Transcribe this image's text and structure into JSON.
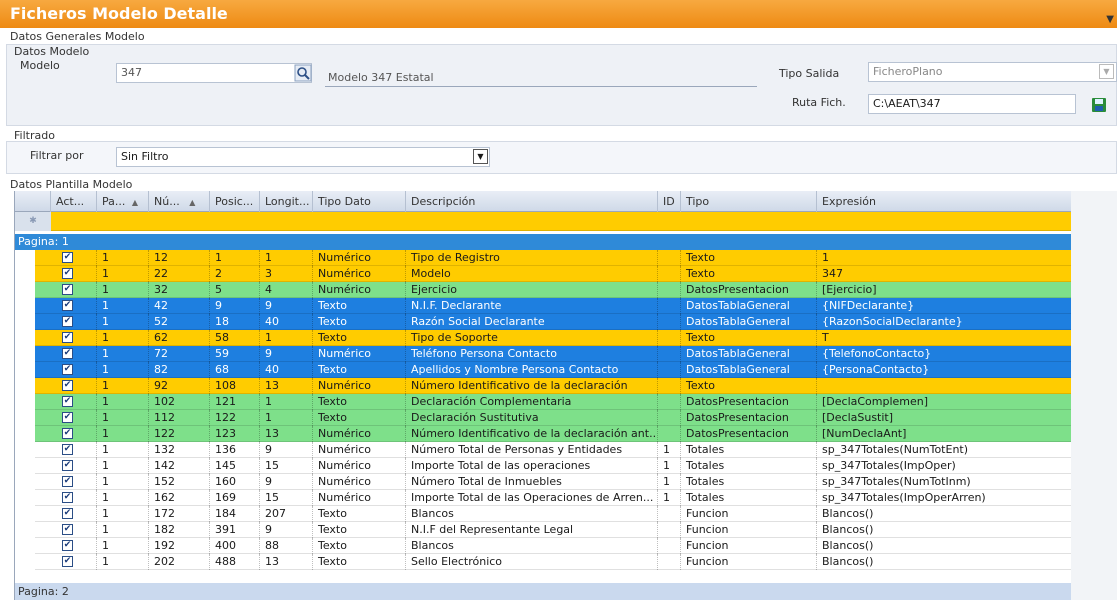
{
  "window": {
    "title": "Ficheros Modelo Detalle"
  },
  "sections": {
    "general": "Datos Generales Modelo",
    "modelo_group": "Datos Modelo",
    "filtrado": "Filtrado",
    "plantilla": "Datos Plantilla Modelo"
  },
  "modelo": {
    "label": "Modelo",
    "value": "347",
    "description": "Modelo 347 Estatal"
  },
  "tipo_salida": {
    "label": "Tipo Salida",
    "value": "FicheroPlano"
  },
  "ruta": {
    "label": "Ruta Fich.",
    "value": "C:\\AEAT\\347"
  },
  "filtro": {
    "label": "Filtrar por",
    "value": "Sin Filtro"
  },
  "grid": {
    "columns": [
      "Act...",
      "Pa...",
      "Nú...",
      "Posic...",
      "Longit...",
      "Tipo Dato",
      "Descripción",
      "ID",
      "Tipo",
      "Expresión"
    ],
    "sort_indicator": "▲",
    "groups": [
      "Pagina: 1",
      "Pagina: 2"
    ],
    "rows": [
      {
        "pa": "1",
        "num": "12",
        "pos": "1",
        "lon": "1",
        "tipodato": "Numérico",
        "desc": "Tipo de Registro",
        "id": "",
        "tipo": "Texto",
        "expr": "1",
        "color": "yellow"
      },
      {
        "pa": "1",
        "num": "22",
        "pos": "2",
        "lon": "3",
        "tipodato": "Numérico",
        "desc": "Modelo",
        "id": "",
        "tipo": "Texto",
        "expr": "347",
        "color": "yellow"
      },
      {
        "pa": "1",
        "num": "32",
        "pos": "5",
        "lon": "4",
        "tipodato": "Numérico",
        "desc": "Ejercicio",
        "id": "",
        "tipo": "DatosPresentacion",
        "expr": "[Ejercicio]",
        "color": "green"
      },
      {
        "pa": "1",
        "num": "42",
        "pos": "9",
        "lon": "9",
        "tipodato": "Texto",
        "desc": "N.I.F. Declarante",
        "id": "",
        "tipo": "DatosTablaGeneral",
        "expr": "{NIFDeclarante}",
        "color": "blue"
      },
      {
        "pa": "1",
        "num": "52",
        "pos": "18",
        "lon": "40",
        "tipodato": "Texto",
        "desc": "Razón Social Declarante",
        "id": "",
        "tipo": "DatosTablaGeneral",
        "expr": "{RazonSocialDeclarante}",
        "color": "blue"
      },
      {
        "pa": "1",
        "num": "62",
        "pos": "58",
        "lon": "1",
        "tipodato": "Texto",
        "desc": "Tipo de Soporte",
        "id": "",
        "tipo": "Texto",
        "expr": "T",
        "color": "yellow"
      },
      {
        "pa": "1",
        "num": "72",
        "pos": "59",
        "lon": "9",
        "tipodato": "Numérico",
        "desc": "Teléfono Persona Contacto",
        "id": "",
        "tipo": "DatosTablaGeneral",
        "expr": "{TelefonoContacto}",
        "color": "blue"
      },
      {
        "pa": "1",
        "num": "82",
        "pos": "68",
        "lon": "40",
        "tipodato": "Texto",
        "desc": "Apellidos y Nombre Persona Contacto",
        "id": "",
        "tipo": "DatosTablaGeneral",
        "expr": "{PersonaContacto}",
        "color": "blue"
      },
      {
        "pa": "1",
        "num": "92",
        "pos": "108",
        "lon": "13",
        "tipodato": "Numérico",
        "desc": "Número Identificativo de la declaración",
        "id": "",
        "tipo": "Texto",
        "expr": "",
        "color": "yellow"
      },
      {
        "pa": "1",
        "num": "102",
        "pos": "121",
        "lon": "1",
        "tipodato": "Texto",
        "desc": "Declaración Complementaria",
        "id": "",
        "tipo": "DatosPresentacion",
        "expr": "[DeclaComplemen]",
        "color": "green"
      },
      {
        "pa": "1",
        "num": "112",
        "pos": "122",
        "lon": "1",
        "tipodato": "Texto",
        "desc": "Declaración Sustitutiva",
        "id": "",
        "tipo": "DatosPresentacion",
        "expr": "[DeclaSustit]",
        "color": "green"
      },
      {
        "pa": "1",
        "num": "122",
        "pos": "123",
        "lon": "13",
        "tipodato": "Numérico",
        "desc": "Número Identificativo de la declaración ant...",
        "id": "",
        "tipo": "DatosPresentacion",
        "expr": "[NumDeclaAnt]",
        "color": "green"
      },
      {
        "pa": "1",
        "num": "132",
        "pos": "136",
        "lon": "9",
        "tipodato": "Numérico",
        "desc": "Número Total de Personas y Entidades",
        "id": "1",
        "tipo": "Totales",
        "expr": "sp_347Totales(NumTotEnt)",
        "color": "white"
      },
      {
        "pa": "1",
        "num": "142",
        "pos": "145",
        "lon": "15",
        "tipodato": "Numérico",
        "desc": "Importe Total de las operaciones",
        "id": "1",
        "tipo": "Totales",
        "expr": "sp_347Totales(ImpOper)",
        "color": "white"
      },
      {
        "pa": "1",
        "num": "152",
        "pos": "160",
        "lon": "9",
        "tipodato": "Numérico",
        "desc": "Número Total de Inmuebles",
        "id": "1",
        "tipo": "Totales",
        "expr": "sp_347Totales(NumTotInm)",
        "color": "white"
      },
      {
        "pa": "1",
        "num": "162",
        "pos": "169",
        "lon": "15",
        "tipodato": "Numérico",
        "desc": "Importe Total de las Operaciones de Arren...",
        "id": "1",
        "tipo": "Totales",
        "expr": "sp_347Totales(ImpOperArren)",
        "color": "white"
      },
      {
        "pa": "1",
        "num": "172",
        "pos": "184",
        "lon": "207",
        "tipodato": "Texto",
        "desc": "Blancos",
        "id": "",
        "tipo": "Funcion",
        "expr": "Blancos()",
        "color": "white"
      },
      {
        "pa": "1",
        "num": "182",
        "pos": "391",
        "lon": "9",
        "tipodato": "Texto",
        "desc": "N.I.F del Representante Legal",
        "id": "",
        "tipo": "Funcion",
        "expr": "Blancos()",
        "color": "white"
      },
      {
        "pa": "1",
        "num": "192",
        "pos": "400",
        "lon": "88",
        "tipodato": "Texto",
        "desc": "Blancos",
        "id": "",
        "tipo": "Funcion",
        "expr": "Blancos()",
        "color": "white"
      },
      {
        "pa": "1",
        "num": "202",
        "pos": "488",
        "lon": "13",
        "tipodato": "Texto",
        "desc": "Sello Electrónico",
        "id": "",
        "tipo": "Funcion",
        "expr": "Blancos()",
        "color": "white"
      }
    ]
  },
  "colors": {
    "title": "#ee8a13",
    "yellow": "#ffcc00",
    "green": "#7ee08a",
    "blue": "#1e7fe0"
  }
}
